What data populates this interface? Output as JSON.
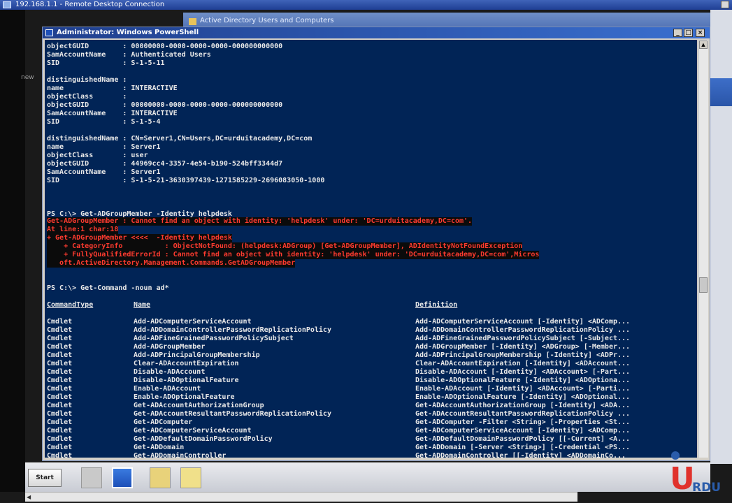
{
  "rdp": {
    "title": "192.168.1.1 - Remote Desktop Connection"
  },
  "ad_window": {
    "title": "Active Directory Users and Computers"
  },
  "left_note": "new",
  "ps": {
    "title": "Administrator: Windows PowerShell",
    "lines": [
      "objectGUID        : 00000000-0000-0000-0000-000000000000",
      "SamAccountName    : Authenticated Users",
      "SID               : S-1-5-11",
      "",
      "distinguishedName :",
      "name              : INTERACTIVE",
      "objectClass       :",
      "objectGUID        : 00000000-0000-0000-0000-000000000000",
      "SamAccountName    : INTERACTIVE",
      "SID               : S-1-5-4",
      "",
      "distinguishedName : CN=Server1,CN=Users,DC=urduitacademy,DC=com",
      "name              : Server1",
      "objectClass       : user",
      "objectGUID        : 44969cc4-3357-4e54-b190-524bff3344d7",
      "SamAccountName    : Server1",
      "SID               : S-1-5-21-3630397439-1271585229-2696083050-1000",
      "",
      "",
      "",
      "PS C:\\> Get-ADGroupMember -Identity helpdesk"
    ],
    "error_lines": [
      "Get-ADGroupMember : Cannot find an object with identity: 'helpdesk' under: 'DC=urduitacademy,DC=com'.",
      "At line:1 char:18",
      "+ Get-ADGroupMember <<<<  -Identity helpdesk",
      "    + CategoryInfo          : ObjectNotFound: (helpdesk:ADGroup) [Get-ADGroupMember], ADIdentityNotFoundException",
      "    + FullyQualifiedErrorId : Cannot find an object with identity: 'helpdesk' under: 'DC=urduitacademy,DC=com',Micros",
      "   oft.ActiveDirectory.Management.Commands.GetADGroupMember"
    ],
    "command2": "PS C:\\> Get-Command -noun ad*",
    "table": {
      "headers": {
        "type": "CommandType",
        "name": "Name",
        "definition": "Definition"
      },
      "rows": [
        {
          "type": "Cmdlet",
          "name": "Add-ADComputerServiceAccount",
          "definition": "Add-ADComputerServiceAccount [-Identity] <ADComp..."
        },
        {
          "type": "Cmdlet",
          "name": "Add-ADDomainControllerPasswordReplicationPolicy",
          "definition": "Add-ADDomainControllerPasswordReplicationPolicy ..."
        },
        {
          "type": "Cmdlet",
          "name": "Add-ADFineGrainedPasswordPolicySubject",
          "definition": "Add-ADFineGrainedPasswordPolicySubject [-Subject..."
        },
        {
          "type": "Cmdlet",
          "name": "Add-ADGroupMember",
          "definition": "Add-ADGroupMember [-Identity] <ADGroup> [-Member..."
        },
        {
          "type": "Cmdlet",
          "name": "Add-ADPrincipalGroupMembership",
          "definition": "Add-ADPrincipalGroupMembership [-Identity] <ADPr..."
        },
        {
          "type": "Cmdlet",
          "name": "Clear-ADAccountExpiration",
          "definition": "Clear-ADAccountExpiration [-Identity] <ADAccount..."
        },
        {
          "type": "Cmdlet",
          "name": "Disable-ADAccount",
          "definition": "Disable-ADAccount [-Identity] <ADAccount> [-Part..."
        },
        {
          "type": "Cmdlet",
          "name": "Disable-ADOptionalFeature",
          "definition": "Disable-ADOptionalFeature [-Identity] <ADOptiona..."
        },
        {
          "type": "Cmdlet",
          "name": "Enable-ADAccount",
          "definition": "Enable-ADAccount [-Identity] <ADAccount> [-Parti..."
        },
        {
          "type": "Cmdlet",
          "name": "Enable-ADOptionalFeature",
          "definition": "Enable-ADOptionalFeature [-Identity] <ADOptional..."
        },
        {
          "type": "Cmdlet",
          "name": "Get-ADAccountAuthorizationGroup",
          "definition": "Get-ADAccountAuthorizationGroup [-Identity] <ADA..."
        },
        {
          "type": "Cmdlet",
          "name": "Get-ADAccountResultantPasswordReplicationPolicy",
          "definition": "Get-ADAccountResultantPasswordReplicationPolicy ..."
        },
        {
          "type": "Cmdlet",
          "name": "Get-ADComputer",
          "definition": "Get-ADComputer -Filter <String> [-Properties <St..."
        },
        {
          "type": "Cmdlet",
          "name": "Get-ADComputerServiceAccount",
          "definition": "Get-ADComputerServiceAccount [-Identity] <ADComp..."
        },
        {
          "type": "Cmdlet",
          "name": "Get-ADDefaultDomainPasswordPolicy",
          "definition": "Get-ADDefaultDomainPasswordPolicy [[-Current] <A..."
        },
        {
          "type": "Cmdlet",
          "name": "Get-ADDomain",
          "definition": "Get-ADDomain [-Server <String>] [-Credential <PS..."
        },
        {
          "type": "Cmdlet",
          "name": "Get-ADDomainController",
          "definition": "Get-ADDomainController [[-Identity] <ADDomainCo..."
        }
      ]
    }
  },
  "taskbar": {
    "start_label": "Start"
  },
  "logo": {
    "u": "U",
    "rdu": "RDU"
  },
  "colors": {
    "console_bg": "#012456",
    "console_fg": "#e8e8e8",
    "error_fg": "#ff3b2f"
  }
}
